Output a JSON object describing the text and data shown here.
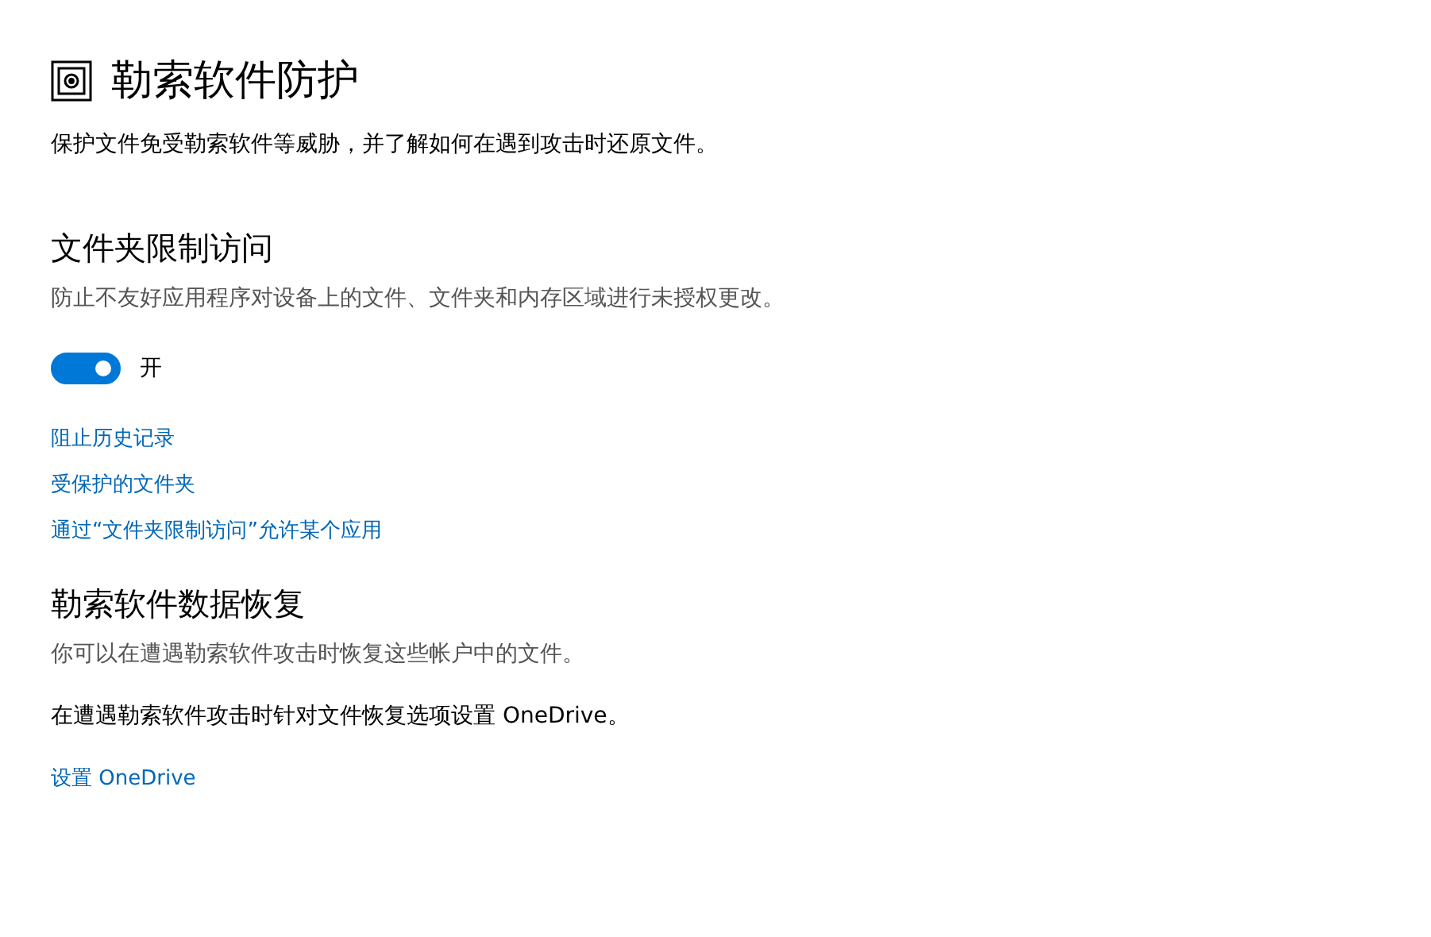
{
  "page": {
    "title": "勒索软件防护",
    "description": "保护文件免受勒索软件等威胁，并了解如何在遇到攻击时还原文件。"
  },
  "folder_access": {
    "heading": "文件夹限制访问",
    "description": "防止不友好应用程序对设备上的文件、文件夹和内存区域进行未授权更改。",
    "toggle": {
      "on": true,
      "label": "开"
    },
    "links": [
      "阻止历史记录",
      "受保护的文件夹",
      "通过“文件夹限制访问”允许某个应用"
    ]
  },
  "recovery": {
    "heading": "勒索软件数据恢复",
    "description": "你可以在遭遇勒索软件攻击时恢复这些帐户中的文件。",
    "note": "在遭遇勒索软件攻击时针对文件恢复选项设置 OneDrive。",
    "link": "设置 OneDrive"
  }
}
